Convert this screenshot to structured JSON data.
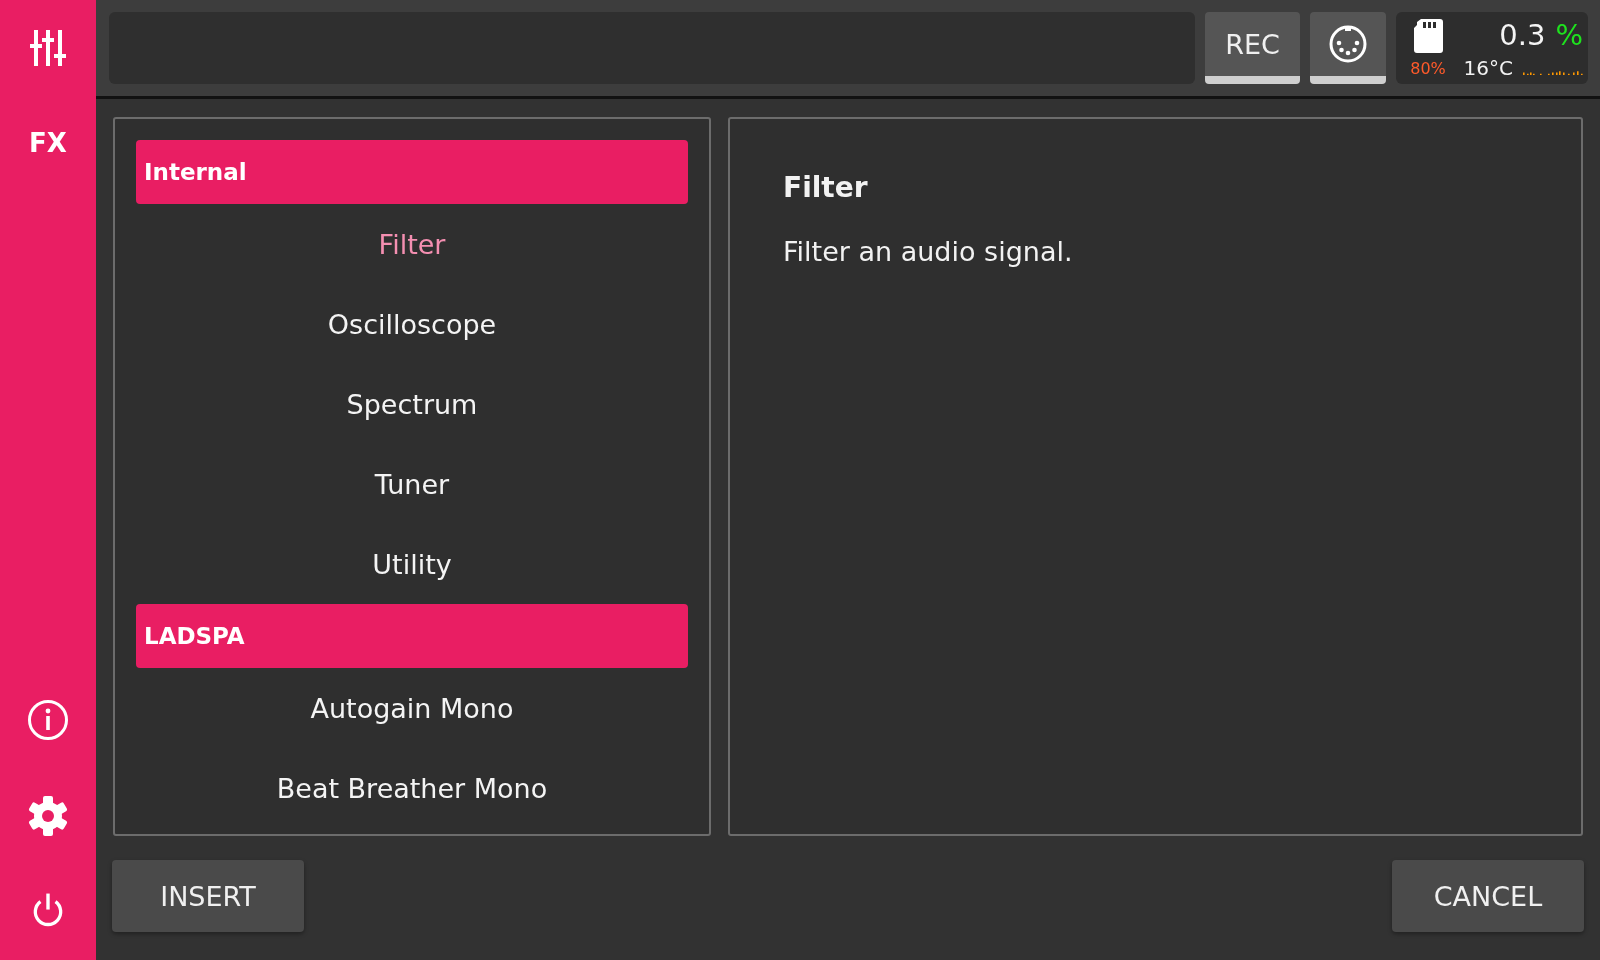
{
  "sidebar": {
    "fx_label": "FX"
  },
  "topbar": {
    "rec_label": "REC",
    "status": {
      "storage": "80%",
      "cpu_load": "0.3",
      "cpu_unit": "%",
      "temperature": "16°C"
    }
  },
  "plugin_list": {
    "groups": [
      {
        "title": "Internal",
        "items": [
          {
            "label": "Filter",
            "selected": true
          },
          {
            "label": "Oscilloscope",
            "selected": false
          },
          {
            "label": "Spectrum",
            "selected": false
          },
          {
            "label": "Tuner",
            "selected": false
          },
          {
            "label": "Utility",
            "selected": false
          }
        ]
      },
      {
        "title": "LADSPA",
        "items": [
          {
            "label": "Autogain Mono",
            "selected": false
          },
          {
            "label": "Beat Breather Mono",
            "selected": false
          }
        ]
      }
    ]
  },
  "details": {
    "title": "Filter",
    "description": "Filter an audio signal."
  },
  "actions": {
    "insert": "INSERT",
    "cancel": "CANCEL"
  }
}
